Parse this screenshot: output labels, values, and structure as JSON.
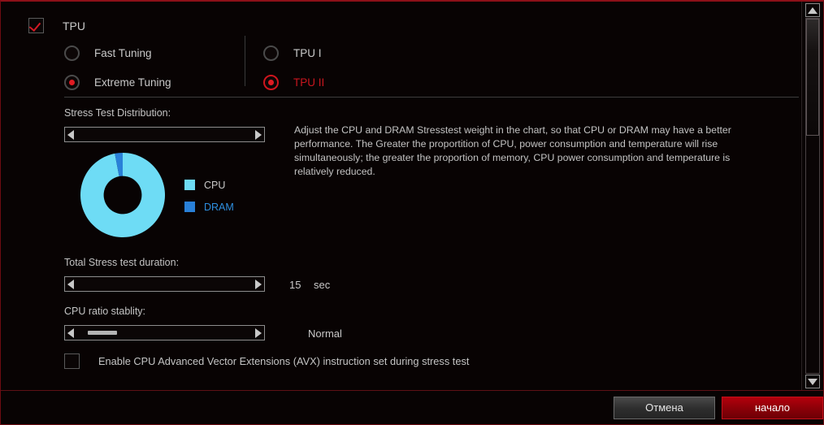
{
  "window": {
    "accent_color": "#c9161e",
    "background": "#080303"
  },
  "tpu": {
    "title": "TPU",
    "checkbox_checked": true,
    "tuning_options": [
      {
        "label": "Fast Tuning",
        "selected": false
      },
      {
        "label": "Extreme Tuning",
        "selected": true
      }
    ],
    "tpu_level_options": [
      {
        "label": "TPU I",
        "selected": false
      },
      {
        "label": "TPU II",
        "selected": true
      }
    ]
  },
  "stress_test_distribution": {
    "label": "Stress Test Distribution:",
    "slider_value_percent": 0,
    "description": "Adjust the CPU and DRAM Stresstest weight in the chart, so that CPU or DRAM may have a better performance. The Greater the proportition of CPU, power consumption and temperature will rise simultaneously; the greater the proportion of memory, CPU power consumption and temperature is relatively reduced."
  },
  "chart_data": {
    "type": "pie",
    "title": "Stress Test Distribution",
    "variant": "donut",
    "categories": [
      "CPU",
      "DRAM"
    ],
    "values": [
      97,
      3
    ],
    "unit": "%",
    "colors": [
      "#6edcf5",
      "#2980d8"
    ],
    "legend": [
      {
        "label": "CPU",
        "color": "#6edcf5",
        "text_color": "#c9c9c9"
      },
      {
        "label": "DRAM",
        "color": "#2980d8",
        "text_color": "#2e8fe0"
      }
    ],
    "legend_position": "right",
    "inner_radius_ratio": 0.45,
    "start_angle_deg": -90
  },
  "duration": {
    "label": "Total Stress test duration:",
    "value": "15",
    "unit": "sec",
    "slider_value_percent": 0
  },
  "cpu_ratio": {
    "label": "CPU ratio stablity:",
    "value": "Normal",
    "slider_value_percent": 6
  },
  "avx": {
    "label": "Enable CPU Advanced Vector Extensions (AVX) instruction set during stress test",
    "checked": false
  },
  "scrollbar": {
    "up_icon": "triangle-up-icon",
    "down_icon": "triangle-down-icon",
    "thumb_position_percent": 0
  },
  "footer": {
    "cancel_label": "Отмена",
    "start_label": "начало"
  }
}
